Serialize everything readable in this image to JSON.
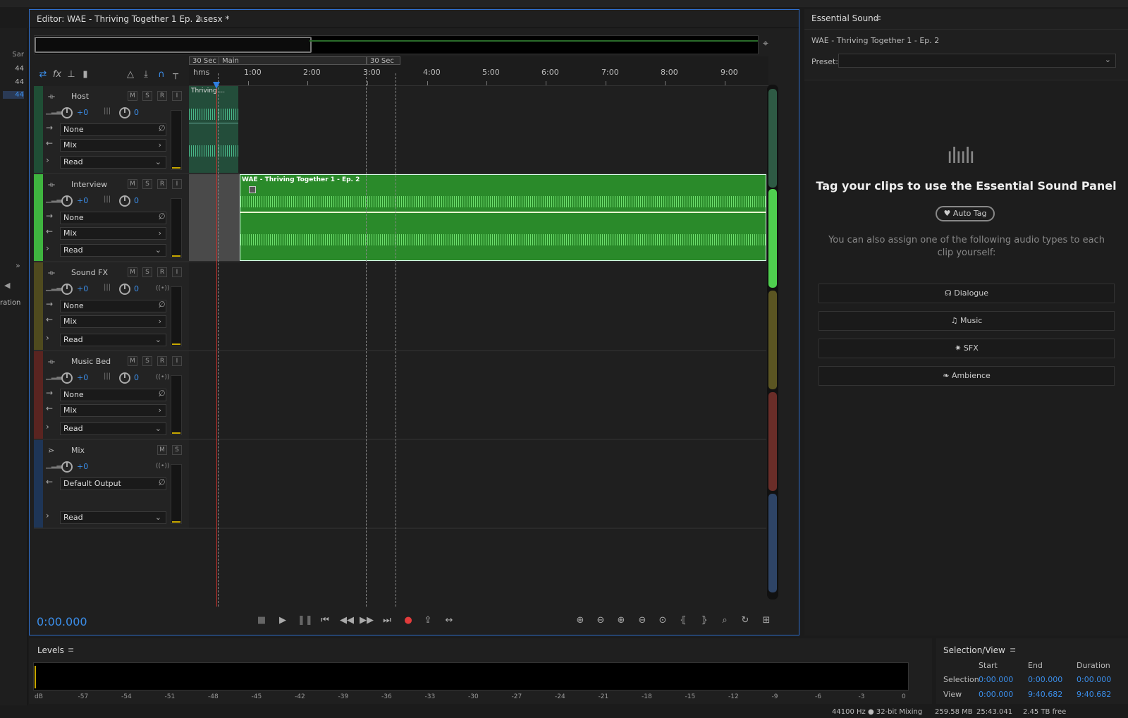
{
  "left_panel": {
    "col_header": "Sar",
    "values": [
      "44",
      "44",
      "44"
    ],
    "label": "ration"
  },
  "editor": {
    "title": "Editor: WAE - Thriving Together 1 Ep. 2.sesx *",
    "ruler": {
      "format": "hms",
      "ticks": [
        "1:00",
        "2:00",
        "3:00",
        "4:00",
        "5:00",
        "6:00",
        "7:00",
        "8:00",
        "9:00"
      ],
      "markers": [
        "30 Sec",
        "Main",
        "30 Sec"
      ]
    },
    "tracks": [
      {
        "name": "Host",
        "vol": "+0",
        "pan": "0",
        "input": "None",
        "output": "Mix",
        "automation": "Read",
        "color": "#1f4e35"
      },
      {
        "name": "Interview",
        "vol": "+0",
        "pan": "0",
        "input": "None",
        "output": "Mix",
        "automation": "Read",
        "color": "#3fb43f"
      },
      {
        "name": "Sound FX",
        "vol": "+0",
        "pan": "0",
        "input": "None",
        "output": "Mix",
        "automation": "Read",
        "color": "#4f4a1e"
      },
      {
        "name": "Music Bed",
        "vol": "+0",
        "pan": "0",
        "input": "None",
        "output": "Mix",
        "automation": "Read",
        "color": "#5a2420"
      },
      {
        "name": "Mix",
        "vol": "+0",
        "output": "Default Output",
        "automation": "Read",
        "color": "#1e3556"
      }
    ],
    "clips": {
      "host_clip": "Thriving ...",
      "interview_clip": "WAE - Thriving Together 1 - Ep. 2"
    },
    "timecode": "0:00.000"
  },
  "essential": {
    "panel_title": "Essential Sound",
    "clip_name": "WAE - Thriving Together 1 - Ep. 2",
    "preset_label": "Preset:",
    "preset_value": "",
    "headline": "Tag your clips to use the Essential Sound Panel",
    "auto_tag": "Auto Tag",
    "description": "You can also assign one of the following audio types to each clip yourself:",
    "types": [
      "Dialogue",
      "Music",
      "SFX",
      "Ambience"
    ]
  },
  "levels": {
    "title": "Levels",
    "scale": [
      "dB",
      "-57",
      "-54",
      "-51",
      "-48",
      "-45",
      "-42",
      "-39",
      "-36",
      "-33",
      "-30",
      "-27",
      "-24",
      "-21",
      "-18",
      "-15",
      "-12",
      "-9",
      "-6",
      "-3",
      "0"
    ]
  },
  "selection_view": {
    "title": "Selection/View",
    "headers": [
      "Start",
      "End",
      "Duration"
    ],
    "rows": [
      {
        "label": "Selection",
        "start": "0:00.000",
        "end": "0:00.000",
        "duration": "0:00.000"
      },
      {
        "label": "View",
        "start": "0:00.000",
        "end": "9:40.682",
        "duration": "9:40.682"
      }
    ]
  },
  "status": {
    "sample": "44100 Hz ● 32-bit Mixing",
    "mem": "259.58 MB",
    "duration": "25:43.041",
    "free": "2.45 TB free"
  }
}
